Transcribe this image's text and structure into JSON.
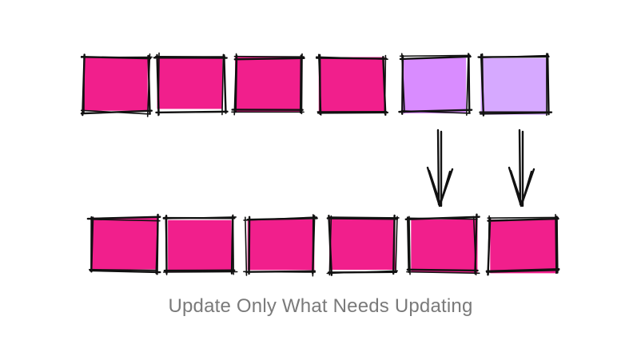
{
  "caption": "Update Only What Needs Updating",
  "colors": {
    "old": "#f11f8c",
    "new_light": "#d98cff",
    "new_lighter": "#d6a9ff",
    "ink": "#111111",
    "caption": "#7a7a7a"
  },
  "top_row": [
    {
      "state": "unchanged"
    },
    {
      "state": "unchanged"
    },
    {
      "state": "unchanged"
    },
    {
      "state": "unchanged"
    },
    {
      "state": "changed",
      "fill": "new_light"
    },
    {
      "state": "changed",
      "fill": "new_lighter"
    }
  ],
  "bottom_row": [
    {
      "state": "unchanged"
    },
    {
      "state": "unchanged"
    },
    {
      "state": "unchanged"
    },
    {
      "state": "unchanged"
    },
    {
      "state": "updated"
    },
    {
      "state": "updated"
    }
  ],
  "arrows": [
    {
      "from_index": 4,
      "to_index": 4,
      "icon": "down-arrow-icon"
    },
    {
      "from_index": 5,
      "to_index": 5,
      "icon": "down-arrow-icon"
    }
  ]
}
